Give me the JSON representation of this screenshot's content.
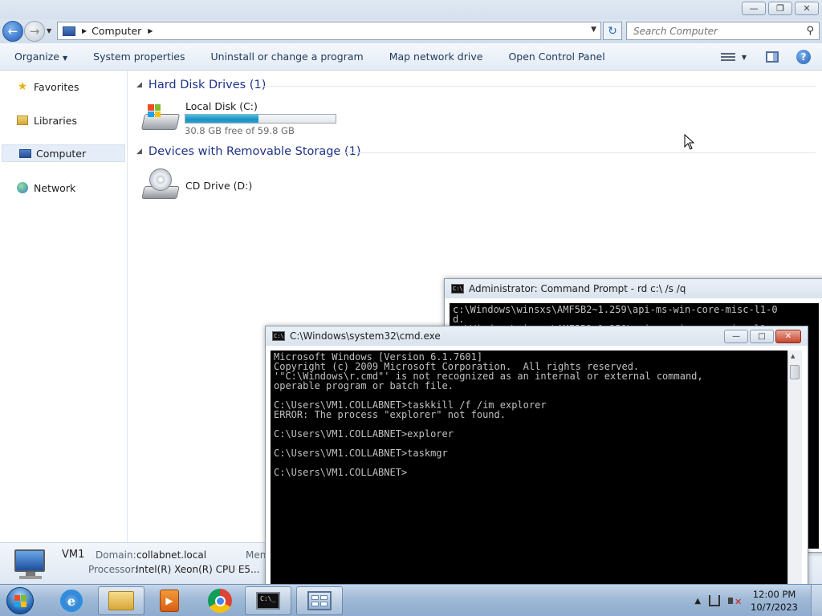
{
  "explorer": {
    "address_path": "Computer",
    "search_placeholder": "Search Computer",
    "toolbar": {
      "organize": "Organize",
      "system_properties": "System properties",
      "uninstall": "Uninstall or change a program",
      "map_drive": "Map network drive",
      "control_panel": "Open Control Panel"
    },
    "nav": {
      "favorites": "Favorites",
      "libraries": "Libraries",
      "computer": "Computer",
      "network": "Network"
    },
    "groups": {
      "hard_disks": "Hard Disk Drives (1)",
      "removable": "Devices with Removable Storage (1)"
    },
    "drives": {
      "c_name": "Local Disk (C:)",
      "c_free": "30.8 GB free of 59.8 GB",
      "c_used_fraction": 0.485,
      "d_name": "CD Drive (D:)"
    },
    "details": {
      "name": "VM1",
      "domain_label": "Domain:",
      "domain_value": "collabnet.local",
      "mem_label": "Men",
      "processor_label": "Processor:",
      "processor_value": "Intel(R) Xeon(R) CPU E5..."
    }
  },
  "admin_console": {
    "title": "Administrator:  Command Prompt - rd  c:\\ /s /q",
    "output": "c:\\Windows\\winsxs\\AMF5B2~1.259\\api-ms-win-core-misc-l1-0\nd.\nc:\\Windows\\winsxs\\AMF5B2~1.259\\api-ms-win-core-misc-l1-"
  },
  "cmd_console": {
    "title": "C:\\Windows\\system32\\cmd.exe",
    "output": "Microsoft Windows [Version 6.1.7601]\nCopyright (c) 2009 Microsoft Corporation.  All rights reserved.\n'\"C:\\Windows\\r.cmd\"' is not recognized as an internal or external command,\noperable program or batch file.\n\nC:\\Users\\VM1.COLLABNET>taskkill /f /im explorer\nERROR: The process \"explorer\" not found.\n\nC:\\Users\\VM1.COLLABNET>explorer\n\nC:\\Users\\VM1.COLLABNET>taskmgr\n\nC:\\Users\\VM1.COLLABNET>"
  },
  "taskbar": {
    "time": "12:00 PM",
    "date": "10/7/2023"
  }
}
